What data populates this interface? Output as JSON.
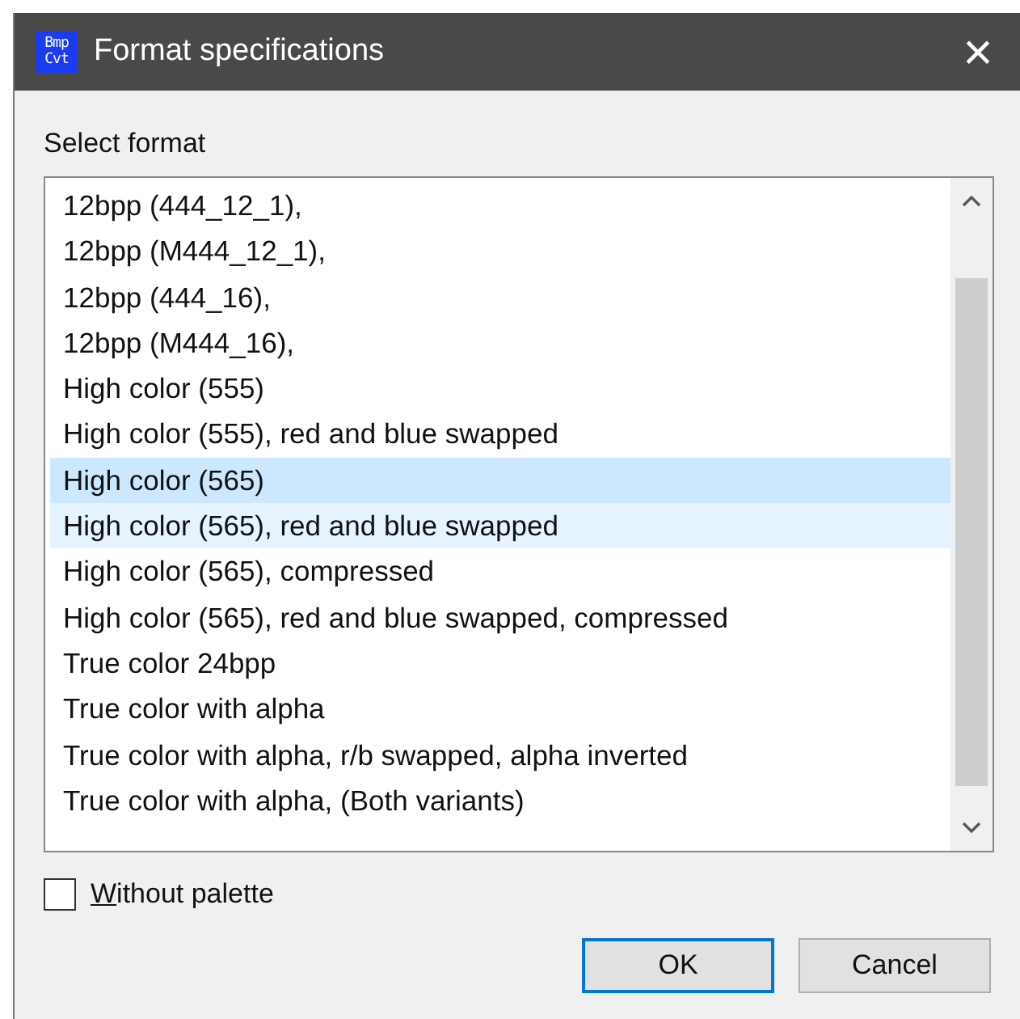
{
  "window": {
    "title": "Format specifications",
    "close": "×",
    "icon_lines": [
      "Bmp",
      "Cvt"
    ]
  },
  "label": "Select format",
  "formats": [
    {
      "label": "12bpp (444_12_1),",
      "selected": false,
      "hovered": false
    },
    {
      "label": "12bpp (M444_12_1),",
      "selected": false,
      "hovered": false
    },
    {
      "label": "12bpp (444_16),",
      "selected": false,
      "hovered": false
    },
    {
      "label": "12bpp (M444_16),",
      "selected": false,
      "hovered": false
    },
    {
      "label": "High color (555)",
      "selected": false,
      "hovered": false
    },
    {
      "label": "High color (555), red and blue swapped",
      "selected": false,
      "hovered": false
    },
    {
      "label": "High color (565)",
      "selected": true,
      "hovered": false
    },
    {
      "label": "High color (565), red and blue swapped",
      "selected": false,
      "hovered": true
    },
    {
      "label": "High color (565), compressed",
      "selected": false,
      "hovered": false
    },
    {
      "label": "High color (565), red and blue swapped, compressed",
      "selected": false,
      "hovered": false
    },
    {
      "label": "True color 24bpp",
      "selected": false,
      "hovered": false
    },
    {
      "label": "True color with alpha",
      "selected": false,
      "hovered": false
    },
    {
      "label": "True color with alpha, r/b swapped, alpha inverted",
      "selected": false,
      "hovered": false
    },
    {
      "label": "True color with alpha, (Both variants)",
      "selected": false,
      "hovered": false
    }
  ],
  "without_palette": {
    "label": "Without palette",
    "checked": false
  },
  "buttons": [
    {
      "label": "OK",
      "default": true
    },
    {
      "label": "Cancel",
      "default": false
    }
  ]
}
